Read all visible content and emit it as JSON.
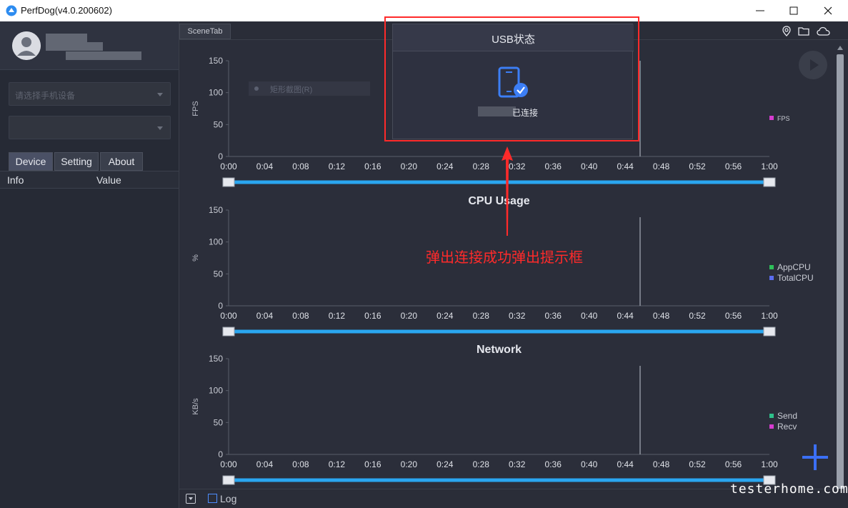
{
  "window": {
    "title": "PerfDog(v4.0.200602)",
    "controls": [
      "minimize",
      "maximize",
      "close"
    ]
  },
  "left_panel": {
    "device_select_placeholder": "请选择手机设备",
    "app_select_placeholder": "",
    "tabs": [
      {
        "label": "Device",
        "active": true
      },
      {
        "label": "Setting",
        "active": false
      },
      {
        "label": "About",
        "active": false
      }
    ],
    "table_headers": {
      "info": "Info",
      "value": "Value"
    }
  },
  "main": {
    "scene_tab": "SceneTab",
    "top_icons": [
      "location-icon",
      "folder-icon",
      "cloud-icon"
    ],
    "screen_selector_label": "矩形截图(R)",
    "x_ticks": [
      "0:00",
      "0:04",
      "0:08",
      "0:12",
      "0:16",
      "0:20",
      "0:24",
      "0:28",
      "0:32",
      "0:36",
      "0:40",
      "0:44",
      "0:48",
      "0:52",
      "0:56",
      "1:00"
    ],
    "bottom": {
      "log_label": "Log"
    }
  },
  "charts": [
    {
      "name": "fps",
      "title": "",
      "ylabel": "FPS",
      "y_ticks": [
        "150",
        "100",
        "50",
        "0"
      ],
      "legend": [
        {
          "name": "FPS",
          "color": "#d63ccf"
        }
      ]
    },
    {
      "name": "cpu",
      "title": "CPU Usage",
      "ylabel": "%",
      "y_ticks": [
        "150",
        "100",
        "50",
        "0"
      ],
      "legend": [
        {
          "name": "AppCPU",
          "color": "#2ec05a"
        },
        {
          "name": "TotalCPU",
          "color": "#5a6cf0"
        }
      ]
    },
    {
      "name": "network",
      "title": "Network",
      "ylabel": "KB/s",
      "y_ticks": [
        "150",
        "100",
        "50",
        "0"
      ],
      "legend": [
        {
          "name": "Send",
          "color": "#2ec08a"
        },
        {
          "name": "Recv",
          "color": "#d63ccf"
        }
      ]
    }
  ],
  "popup": {
    "title": "USB状态",
    "status_text": "已连接"
  },
  "annotation": {
    "text": "弹出连接成功弹出提示框",
    "color": "#ff2a2a"
  },
  "watermark": "testerhome.com",
  "colors": {
    "accent": "#2aa6f0",
    "highlight": "#ff2a2a",
    "background": "#2b2e3a"
  }
}
